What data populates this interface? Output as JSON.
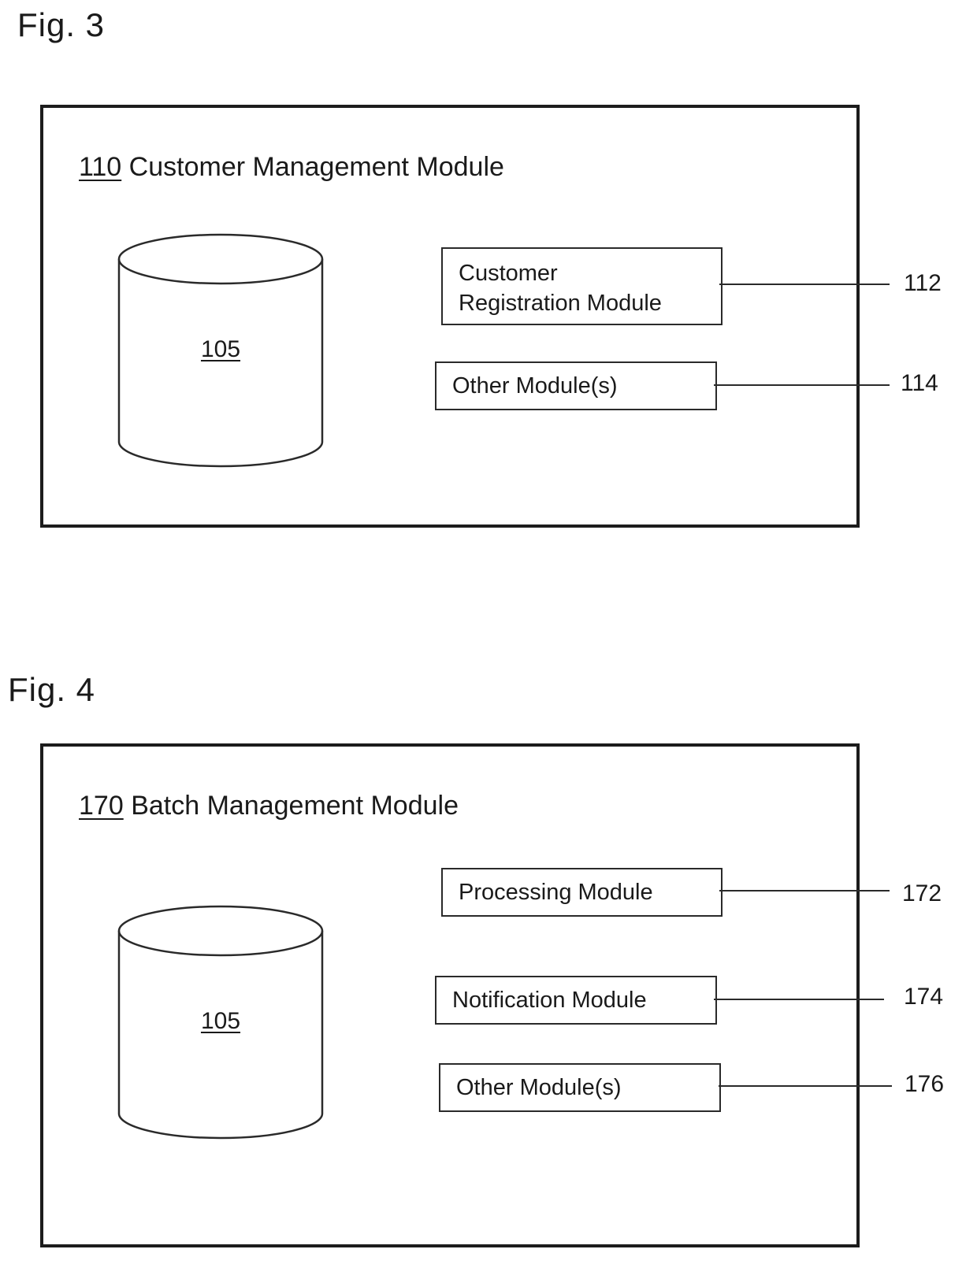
{
  "figures": [
    {
      "label": "Fig. 3",
      "module": {
        "ref": "110",
        "name": "Customer Management Module"
      },
      "database": {
        "ref": "105",
        "icon": "database-cylinder-icon"
      },
      "submodules": [
        {
          "line1": "Customer",
          "line2": "Registration Module",
          "ref": "112"
        },
        {
          "line1": "Other Module(s)",
          "ref": "114"
        }
      ]
    },
    {
      "label": "Fig. 4",
      "module": {
        "ref": "170",
        "name": "Batch Management Module"
      },
      "database": {
        "ref": "105",
        "icon": "database-cylinder-icon"
      },
      "submodules": [
        {
          "line1": "Processing Module",
          "ref": "172"
        },
        {
          "line1": "Notification Module",
          "ref": "174"
        },
        {
          "line1": "Other Module(s)",
          "ref": "176"
        }
      ]
    }
  ],
  "colors": {
    "line": "#1c1c1c",
    "background": "#ffffff"
  }
}
